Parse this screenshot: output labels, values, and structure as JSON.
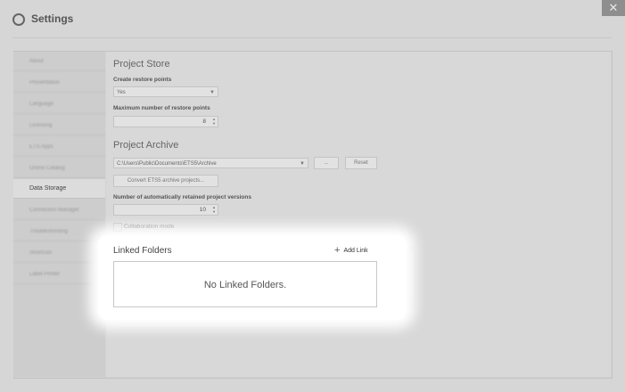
{
  "window": {
    "title": "Settings",
    "close_glyph": "✕"
  },
  "sidebar": {
    "items": [
      {
        "label": "About"
      },
      {
        "label": "Presentation"
      },
      {
        "label": "Language"
      },
      {
        "label": "Licensing"
      },
      {
        "label": "ETS Apps"
      },
      {
        "label": "Online Catalog"
      },
      {
        "label": "Data Storage"
      },
      {
        "label": "Connection Manager"
      },
      {
        "label": "Troubleshooting"
      },
      {
        "label": "Shortcuts"
      },
      {
        "label": "Label Printer"
      }
    ],
    "active_index": 6
  },
  "project_store": {
    "title": "Project Store",
    "restore_points_label": "Create restore points",
    "restore_points_value": "Yes",
    "max_restore_label": "Maximum number of restore points",
    "max_restore_value": "8"
  },
  "project_archive": {
    "title": "Project Archive",
    "path_value": "C:\\Users\\Public\\Documents\\ETS5\\Archive",
    "browse_label": "...",
    "reset_label": "Reset",
    "convert_label": "Convert ETS5 archive projects...",
    "retained_label": "Number of automatically retained project versions",
    "retained_value": "10",
    "collab_label": "Collaboration mode"
  },
  "linked_folders": {
    "title": "Linked Folders",
    "add_link_label": "Add Link",
    "add_link_icon": "plus-icon",
    "empty_text": "No Linked Folders."
  }
}
